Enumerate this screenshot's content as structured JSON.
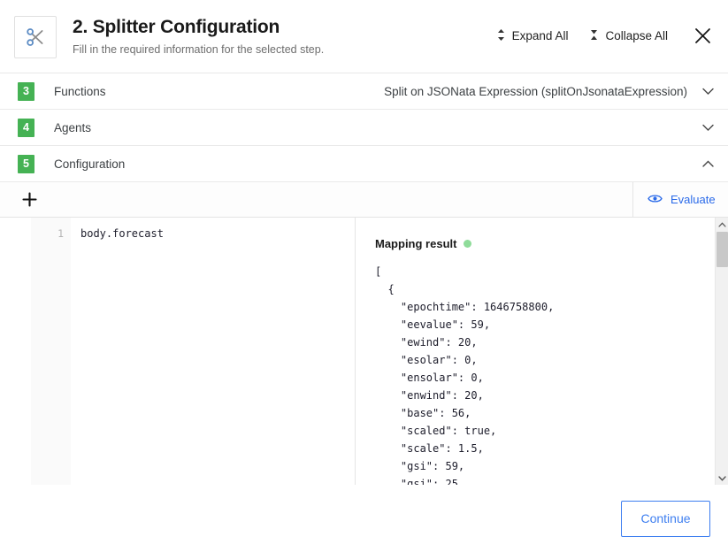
{
  "header": {
    "icon": "scissors-icon",
    "title": "2. Splitter Configuration",
    "subtitle": "Fill in the required information for the selected step.",
    "expand_all_label": "Expand All",
    "collapse_all_label": "Collapse All",
    "expand_icon": "expand-vertical-icon",
    "collapse_icon": "collapse-vertical-icon",
    "close_icon": "close-icon"
  },
  "accordions": [
    {
      "number": "3",
      "label": "Functions",
      "value": "Split on JSONata Expression (splitOnJsonataExpression)",
      "expanded": false,
      "chevron": "chevron-down-icon"
    },
    {
      "number": "4",
      "label": "Agents",
      "value": "",
      "expanded": false,
      "chevron": "chevron-down-icon"
    },
    {
      "number": "5",
      "label": "Configuration",
      "value": "",
      "expanded": true,
      "chevron": "chevron-up-icon"
    }
  ],
  "toolbar": {
    "add_icon": "plus-icon",
    "evaluate_label": "Evaluate",
    "evaluate_icon": "eye-icon"
  },
  "editor": {
    "line_number": "1",
    "code": "body.forecast"
  },
  "result": {
    "title": "Mapping result",
    "status_color": "#8fdc9a",
    "json": "[\n  {\n    \"epochtime\": 1646758800,\n    \"eevalue\": 59,\n    \"ewind\": 20,\n    \"esolar\": 0,\n    \"ensolar\": 0,\n    \"enwind\": 20,\n    \"base\": 56,\n    \"scaled\": true,\n    \"scale\": 1.5,\n    \"gsi\": 59,\n    \"gsi\": 25"
  },
  "scrollbar": {
    "up_icon": "chevron-up-icon",
    "down_icon": "chevron-down-icon"
  },
  "footer": {
    "continue_label": "Continue"
  },
  "colors": {
    "accent_blue": "#3d7ef0",
    "link_blue": "#2a6ae9",
    "badge_green": "#45b254",
    "status_green": "#8fdc9a"
  }
}
